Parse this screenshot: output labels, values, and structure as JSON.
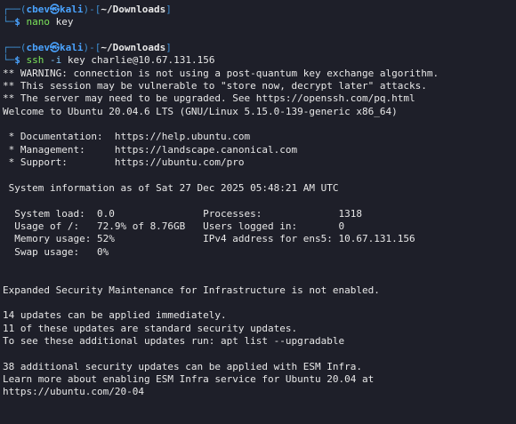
{
  "prompt": {
    "user_host": "cbev㉿kali",
    "path": "~/Downloads",
    "dollar": "$"
  },
  "commands": [
    {
      "program": "nano",
      "flag": "",
      "args": "key"
    },
    {
      "program": "ssh",
      "flag": "-i",
      "args": "key charlie@10.67.131.156"
    }
  ],
  "output": {
    "warnings": [
      "** WARNING: connection is not using a post-quantum key exchange algorithm.",
      "** This session may be vulnerable to \"store now, decrypt later\" attacks.",
      "** The server may need to be upgraded. See https://openssh.com/pq.html"
    ],
    "welcome": "Welcome to Ubuntu 20.04.6 LTS (GNU/Linux 5.15.0-139-generic x86_64)",
    "links": [
      " * Documentation:  https://help.ubuntu.com",
      " * Management:     https://landscape.canonical.com",
      " * Support:        https://ubuntu.com/pro"
    ],
    "sysinfo_title": " System information as of Sat 27 Dec 2025 05:48:21 AM UTC",
    "sysinfo": [
      "  System load:  0.0               Processes:             1318",
      "  Usage of /:   72.9% of 8.76GB   Users logged in:       0",
      "  Memory usage: 52%               IPv4 address for ens5: 10.67.131.156",
      "  Swap usage:   0%"
    ],
    "esm": "Expanded Security Maintenance for Infrastructure is not enabled.",
    "updates": [
      "14 updates can be applied immediately.",
      "11 of these updates are standard security updates.",
      "To see these additional updates run: apt list --upgradable"
    ],
    "esm_updates": [
      "38 additional security updates can be applied with ESM Infra.",
      "Learn more about enabling ESM Infra service for Ubuntu 20.04 at",
      "https://ubuntu.com/20-04"
    ]
  }
}
